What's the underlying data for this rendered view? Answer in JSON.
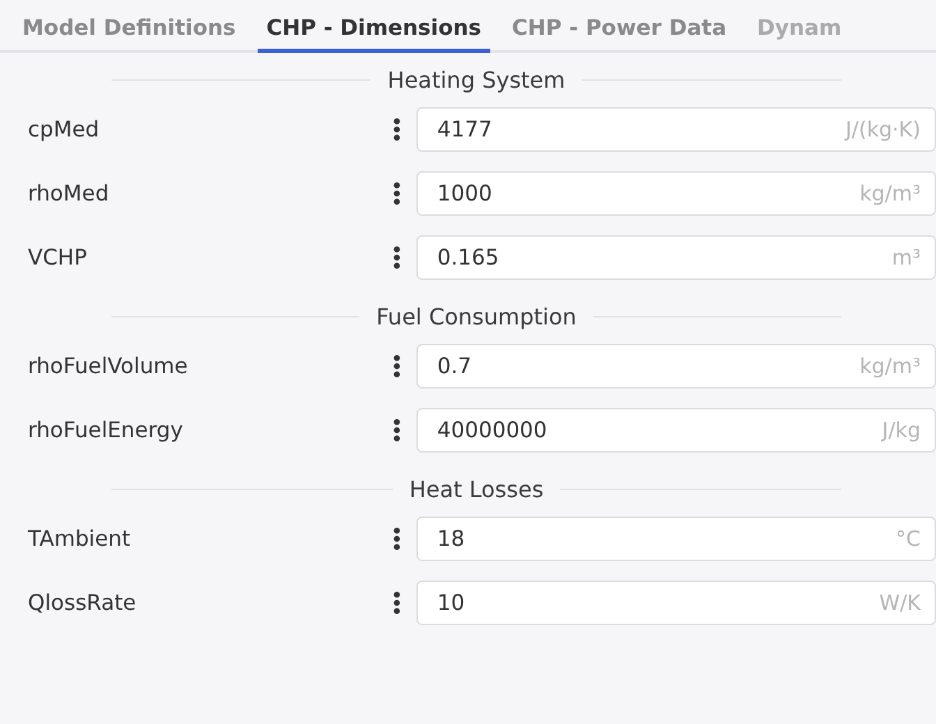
{
  "tabs": [
    {
      "label": "Model Definitions",
      "selected": false
    },
    {
      "label": "CHP - Dimensions",
      "selected": true
    },
    {
      "label": "CHP - Power Data",
      "selected": false
    },
    {
      "label": "Dynam",
      "selected": false
    }
  ],
  "sections": [
    {
      "title": "Heating System",
      "parameters": [
        {
          "name": "cpMed",
          "value": "4177",
          "unit": "J/(kg·K)"
        },
        {
          "name": "rhoMed",
          "value": "1000",
          "unit": "kg/m³"
        },
        {
          "name": "VCHP",
          "value": "0.165",
          "unit": "m³"
        }
      ]
    },
    {
      "title": "Fuel Consumption",
      "parameters": [
        {
          "name": "rhoFuelVolume",
          "value": "0.7",
          "unit": "kg/m³"
        },
        {
          "name": "rhoFuelEnergy",
          "value": "40000000",
          "unit": "J/kg"
        }
      ]
    },
    {
      "title": "Heat Losses",
      "parameters": [
        {
          "name": "TAmbient",
          "value": "18",
          "unit": "°C"
        },
        {
          "name": "QlossRate",
          "value": "10",
          "unit": "W/K"
        }
      ]
    }
  ]
}
